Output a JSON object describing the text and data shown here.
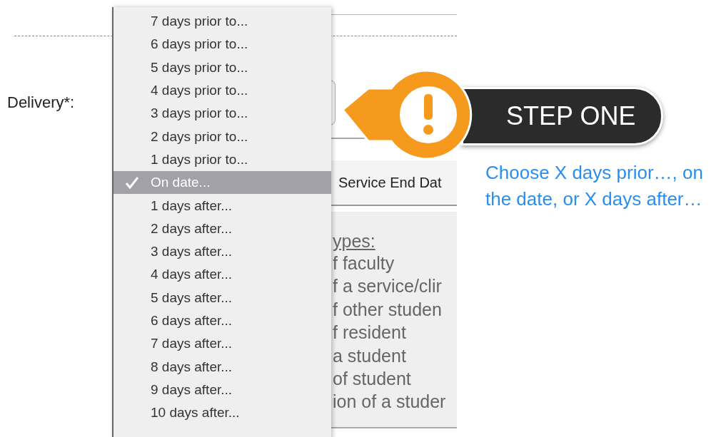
{
  "form": {
    "delivery_label": "Delivery*:",
    "column_header": "Service End Dat",
    "section_heading": "ypes:",
    "section_lines": [
      "f faculty",
      "f a service/clir",
      "f other studen",
      "f resident",
      "a student",
      "of student",
      "ion of a studer"
    ]
  },
  "menu": {
    "items": [
      {
        "label": "7 days prior to...",
        "selected": false
      },
      {
        "label": "6 days prior to...",
        "selected": false
      },
      {
        "label": "5 days prior to...",
        "selected": false
      },
      {
        "label": "4 days prior to...",
        "selected": false
      },
      {
        "label": "3 days prior to...",
        "selected": false
      },
      {
        "label": "2 days prior to...",
        "selected": false
      },
      {
        "label": "1 days prior to...",
        "selected": false
      },
      {
        "label": "On date...",
        "selected": true
      },
      {
        "label": "1 days after...",
        "selected": false
      },
      {
        "label": "2 days after...",
        "selected": false
      },
      {
        "label": "3 days after...",
        "selected": false
      },
      {
        "label": "4 days after...",
        "selected": false
      },
      {
        "label": "5 days after...",
        "selected": false
      },
      {
        "label": "6 days after...",
        "selected": false
      },
      {
        "label": "7 days after...",
        "selected": false
      },
      {
        "label": "8 days after...",
        "selected": false
      },
      {
        "label": "9 days after...",
        "selected": false
      },
      {
        "label": "10 days after...",
        "selected": false
      }
    ]
  },
  "callout": {
    "badge": "STEP ONE",
    "note": "Choose X days prior…, on the date, or X days after…"
  }
}
